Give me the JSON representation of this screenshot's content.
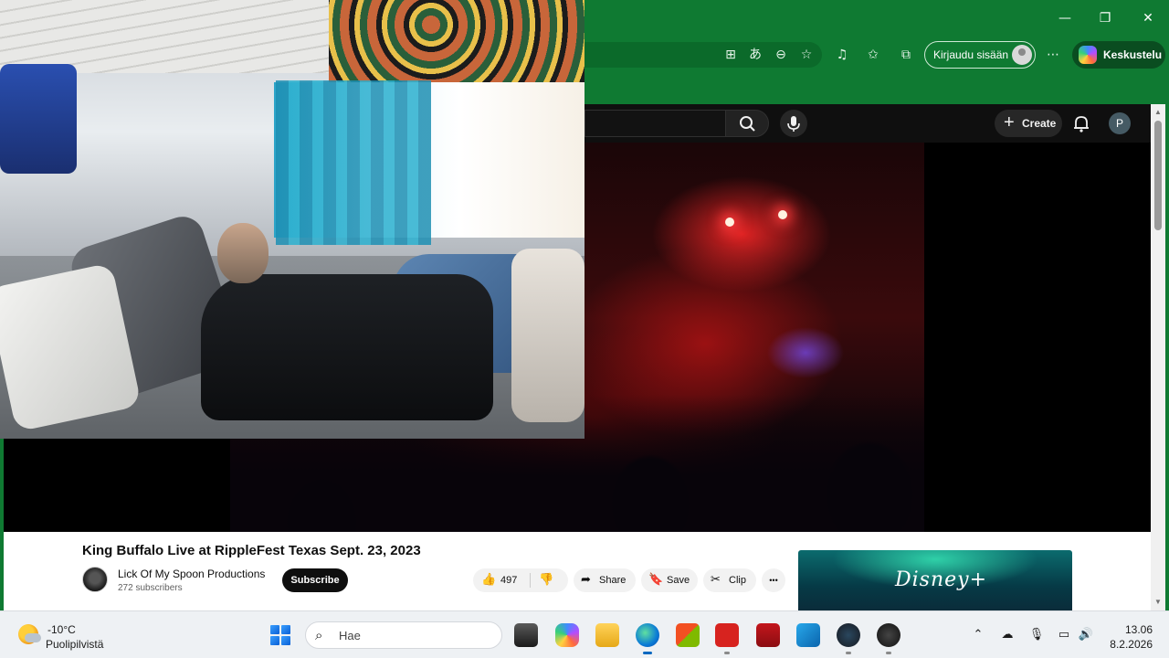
{
  "window": {
    "controls": {
      "minimize": "—",
      "restore": "❐",
      "close": "✕"
    }
  },
  "browser": {
    "signin_label": "Kirjaudu sisään",
    "copilot_label": "Keskustelu"
  },
  "youtube": {
    "create_label": "Create",
    "avatar_letter": "P",
    "video_title": "King Buffalo Live at RippleFest Texas Sept. 23, 2023",
    "channel_name": "Lick Of My Spoon Productions",
    "subscriber_count": "272 subscribers",
    "subscribe_label": "Subscribe",
    "like_count": "497",
    "share_label": "Share",
    "save_label": "Save",
    "clip_label": "Clip",
    "more_label": "•••",
    "ad_text": "Disney+"
  },
  "taskbar": {
    "temperature": "-10°C",
    "condition": "Puolipilvistä",
    "search_placeholder": "Hae",
    "time": "13.06",
    "date": "8.2.2026"
  },
  "colors": {
    "browser_theme": "#0f7a32",
    "youtube_dark": "#0f0f0f",
    "taskbar_bg": "#eef1f4"
  }
}
